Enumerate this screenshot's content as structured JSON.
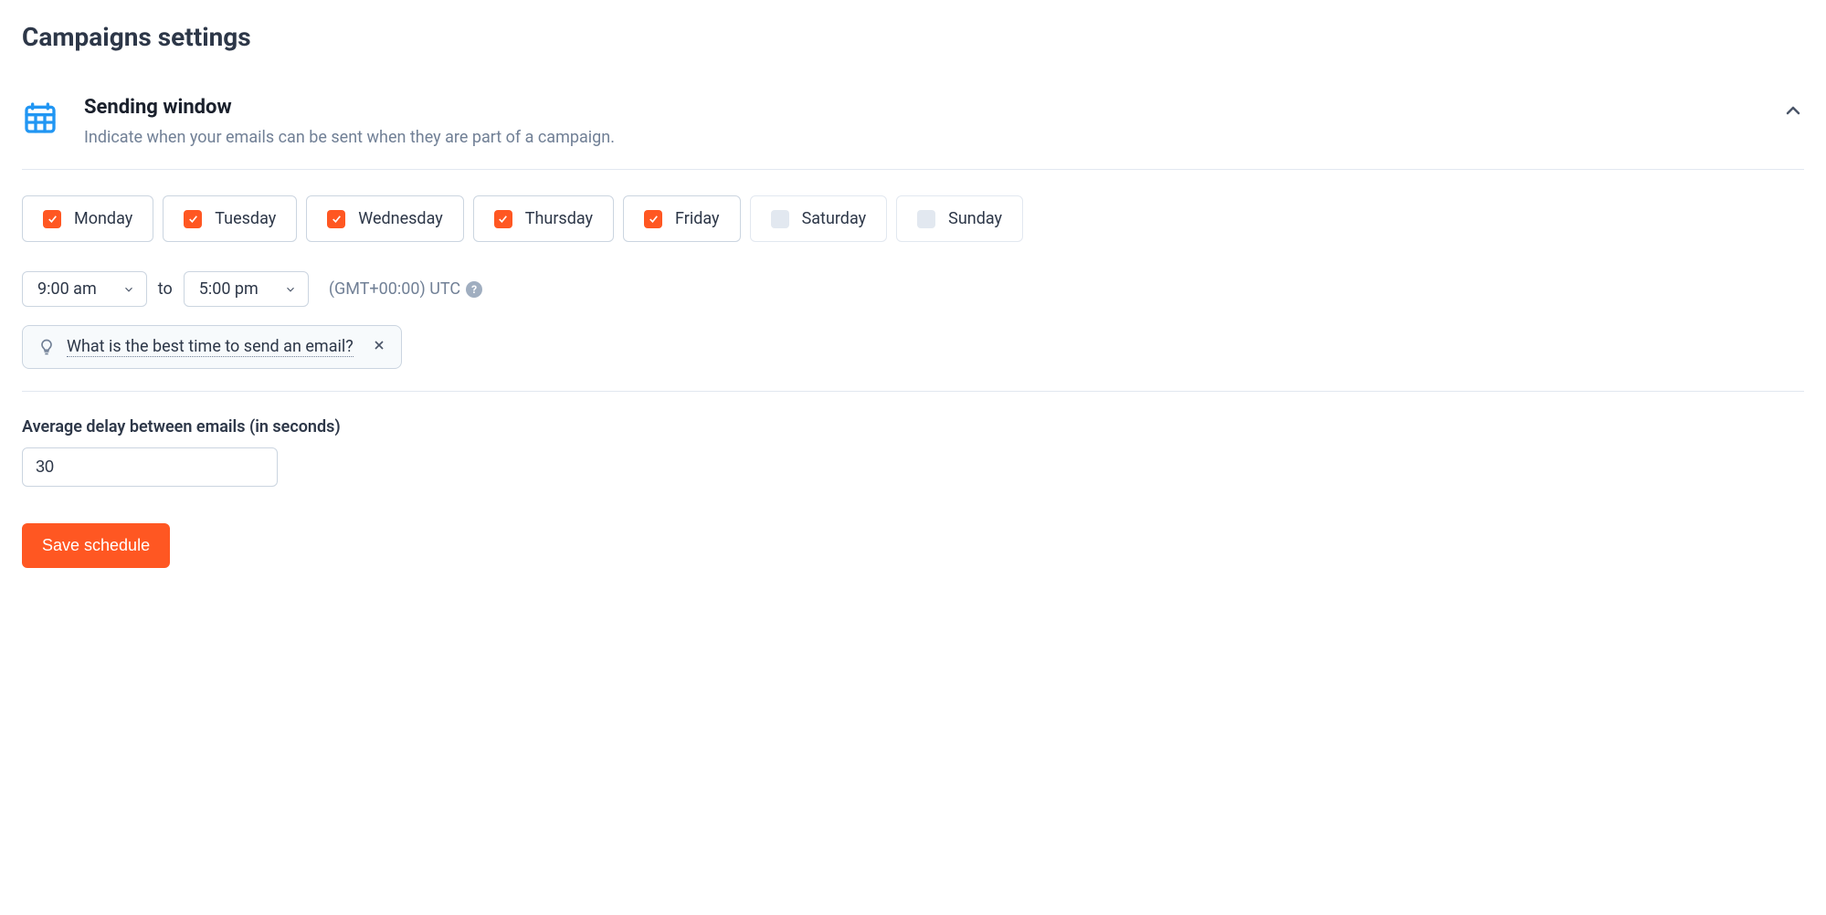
{
  "pageTitle": "Campaigns settings",
  "section": {
    "title": "Sending window",
    "subtitle": "Indicate when your emails can be sent when they are part of a campaign."
  },
  "days": [
    {
      "label": "Monday",
      "checked": true
    },
    {
      "label": "Tuesday",
      "checked": true
    },
    {
      "label": "Wednesday",
      "checked": true
    },
    {
      "label": "Thursday",
      "checked": true
    },
    {
      "label": "Friday",
      "checked": true
    },
    {
      "label": "Saturday",
      "checked": false
    },
    {
      "label": "Sunday",
      "checked": false
    }
  ],
  "time": {
    "start": "9:00 am",
    "sep": "to",
    "end": "5:00 pm",
    "timezone": "(GMT+00:00) UTC"
  },
  "tip": {
    "text": "What is the best time to send an email?"
  },
  "delay": {
    "label": "Average delay between emails (in seconds)",
    "value": "30"
  },
  "saveLabel": "Save schedule"
}
